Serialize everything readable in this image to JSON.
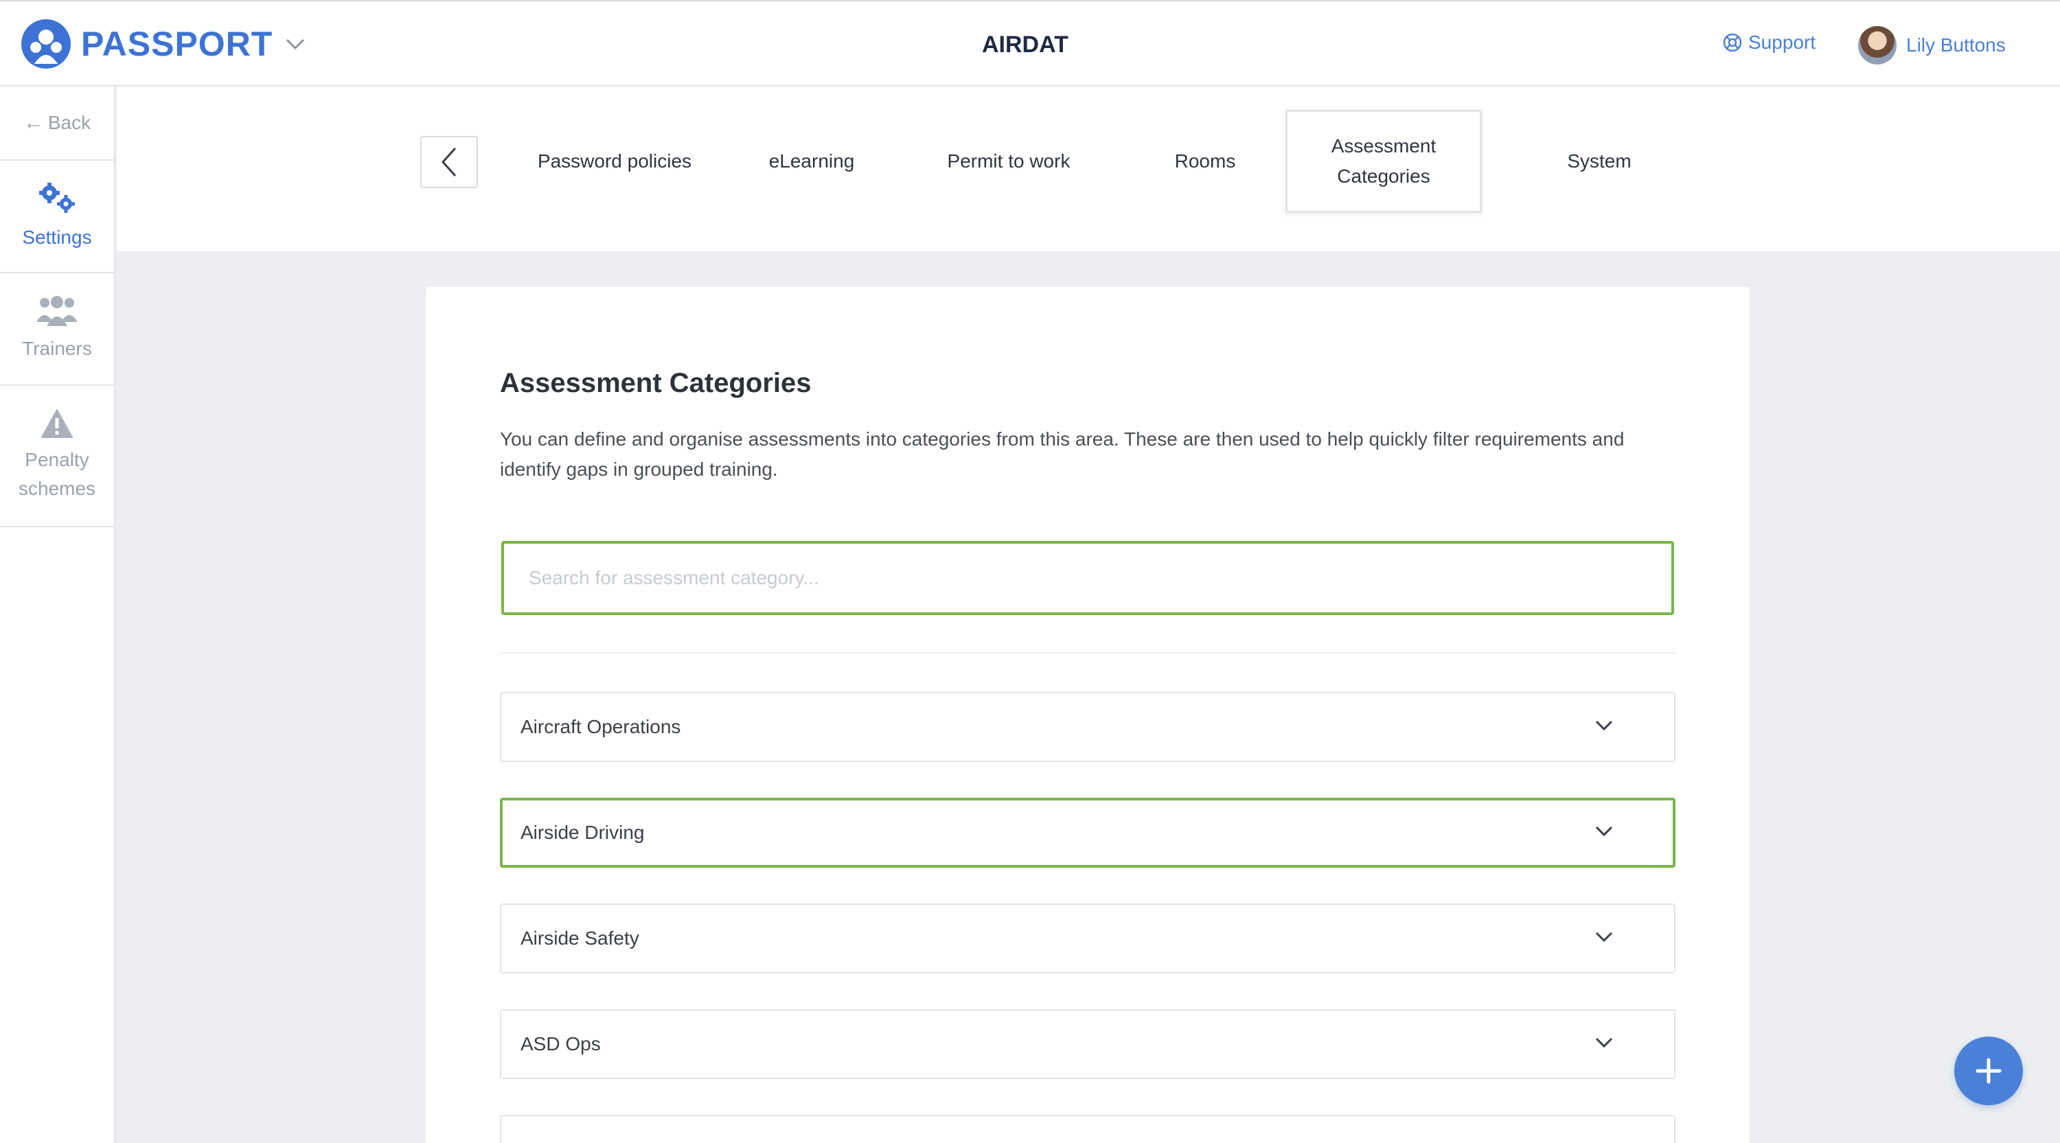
{
  "header": {
    "brand_name": "PASSPORT",
    "center_logo": "AIRDAT",
    "support_label": "Support",
    "user_name": "Lily Buttons"
  },
  "sidebar": {
    "back_label": "Back",
    "items": [
      {
        "label": "Settings",
        "icon": "gears-icon",
        "active": true
      },
      {
        "label": "Trainers",
        "icon": "users-icon",
        "active": false
      },
      {
        "label": "Penalty schemes",
        "icon": "warning-icon",
        "active": false
      }
    ]
  },
  "tabs": [
    {
      "label": "Password policies",
      "active": false
    },
    {
      "label": "eLearning",
      "active": false
    },
    {
      "label": "Permit to work",
      "active": false
    },
    {
      "label": "Rooms",
      "active": false
    },
    {
      "label": "Assessment Categories",
      "active": true
    },
    {
      "label": "System",
      "active": false
    }
  ],
  "main": {
    "title": "Assessment Categories",
    "description": "You can define and organise assessments into categories from this area. These are then used to help quickly filter requirements and identify gaps in grouped training.",
    "search_placeholder": "Search for assessment category...",
    "categories": [
      {
        "label": "Aircraft Operations"
      },
      {
        "label": "Airside Driving"
      },
      {
        "label": "Airside Safety"
      },
      {
        "label": "ASD Ops"
      }
    ]
  },
  "colors": {
    "accent": "#3d73d4",
    "focus_green": "#7ab648",
    "fab": "#4a80d8"
  }
}
